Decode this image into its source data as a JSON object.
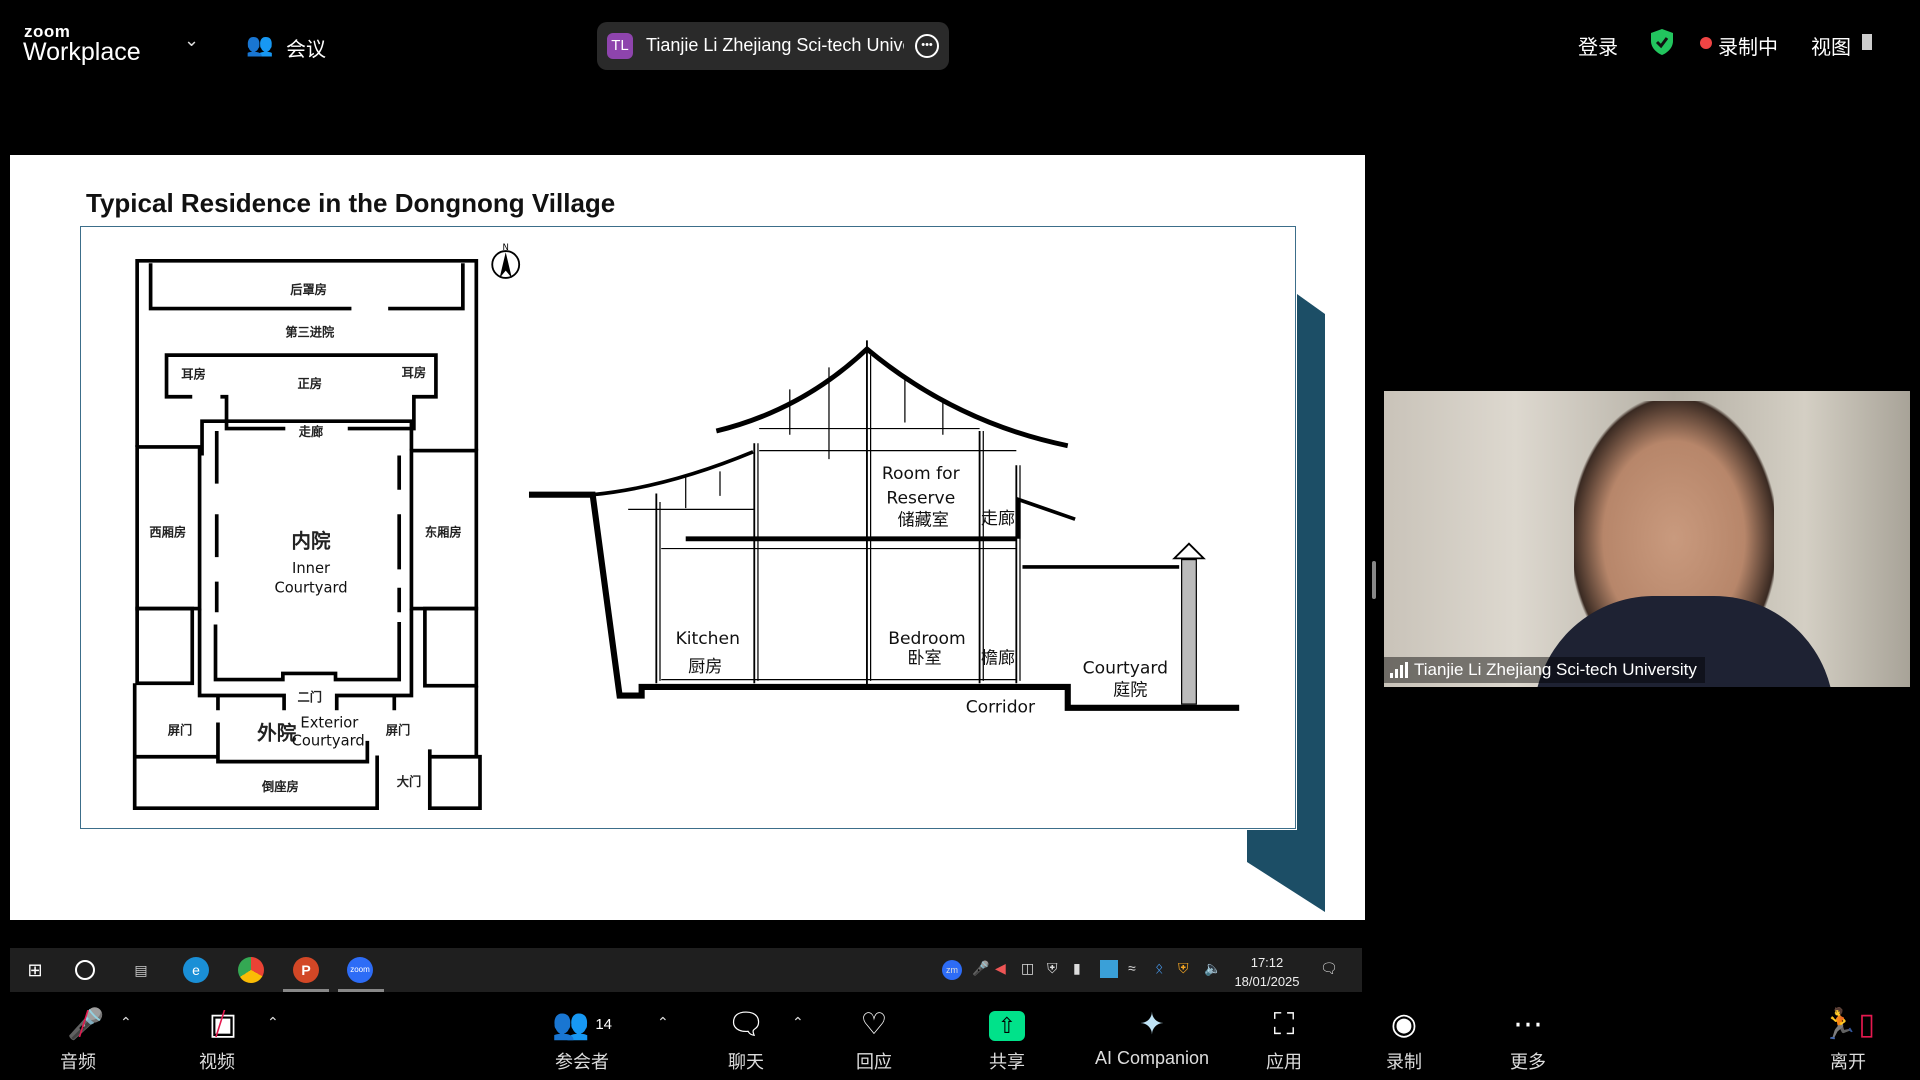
{
  "app": {
    "logo_top": "zoom",
    "logo_bottom": "Workplace",
    "meeting_label": "会议"
  },
  "host": {
    "initials": "TL",
    "name": "Tianjie Li Zhejiang Sci-tech University",
    "avatar_color": "#8e44ad"
  },
  "top_right": {
    "login": "登录",
    "recording": "录制中",
    "view": "视图",
    "shield_color": "#22c55e",
    "rec_color": "#ef4444"
  },
  "slide": {
    "title": "Typical Residence in the Dongnong Village",
    "north": "N",
    "plan": {
      "rear": "后罩房",
      "third_yard": "第三进院",
      "ear_left": "耳房",
      "main": "正房",
      "ear_right": "耳房",
      "corridor": "走廊",
      "west": "西厢房",
      "inner_cn": "内院",
      "inner_en1": "Inner",
      "inner_en2": "Courtyard",
      "east": "东厢房",
      "second_gate": "二门",
      "outer_cn": "外院",
      "outer_en1": "Exterior",
      "outer_en2": "Courtyard",
      "screen_left": "屏门",
      "screen_right": "屏门",
      "south": "倒座房",
      "gate": "大门"
    },
    "section": {
      "reserve1": "Room for",
      "reserve2": "Reserve",
      "reserve_cn": "储藏室",
      "corridor_up": "走廊",
      "kitchen": "Kitchen",
      "kitchen_cn": "厨房",
      "bedroom": "Bedroom",
      "bedroom_cn": "卧室",
      "veranda": "檐廊",
      "courtyard": "Courtyard",
      "courtyard_cn": "庭院",
      "corridor": "Corridor"
    },
    "accent": "#1c4e66"
  },
  "taskbar": {
    "apps": [
      "windows-start",
      "search",
      "task-view",
      "edge",
      "chrome",
      "powerpoint",
      "zoom"
    ],
    "time": "17:12",
    "date": "18/01/2025"
  },
  "video": {
    "name": "Tianjie Li Zhejiang Sci-tech University"
  },
  "toolbar": {
    "audio": "音频",
    "video": "视频",
    "participants": "参会者",
    "participants_count": "14",
    "chat": "聊天",
    "react": "回应",
    "share": "共享",
    "ai": "AI Companion",
    "apps": "应用",
    "record": "录制",
    "more": "更多",
    "leave": "离开",
    "share_color": "#00e28a",
    "leave_color": "#e5194f"
  }
}
